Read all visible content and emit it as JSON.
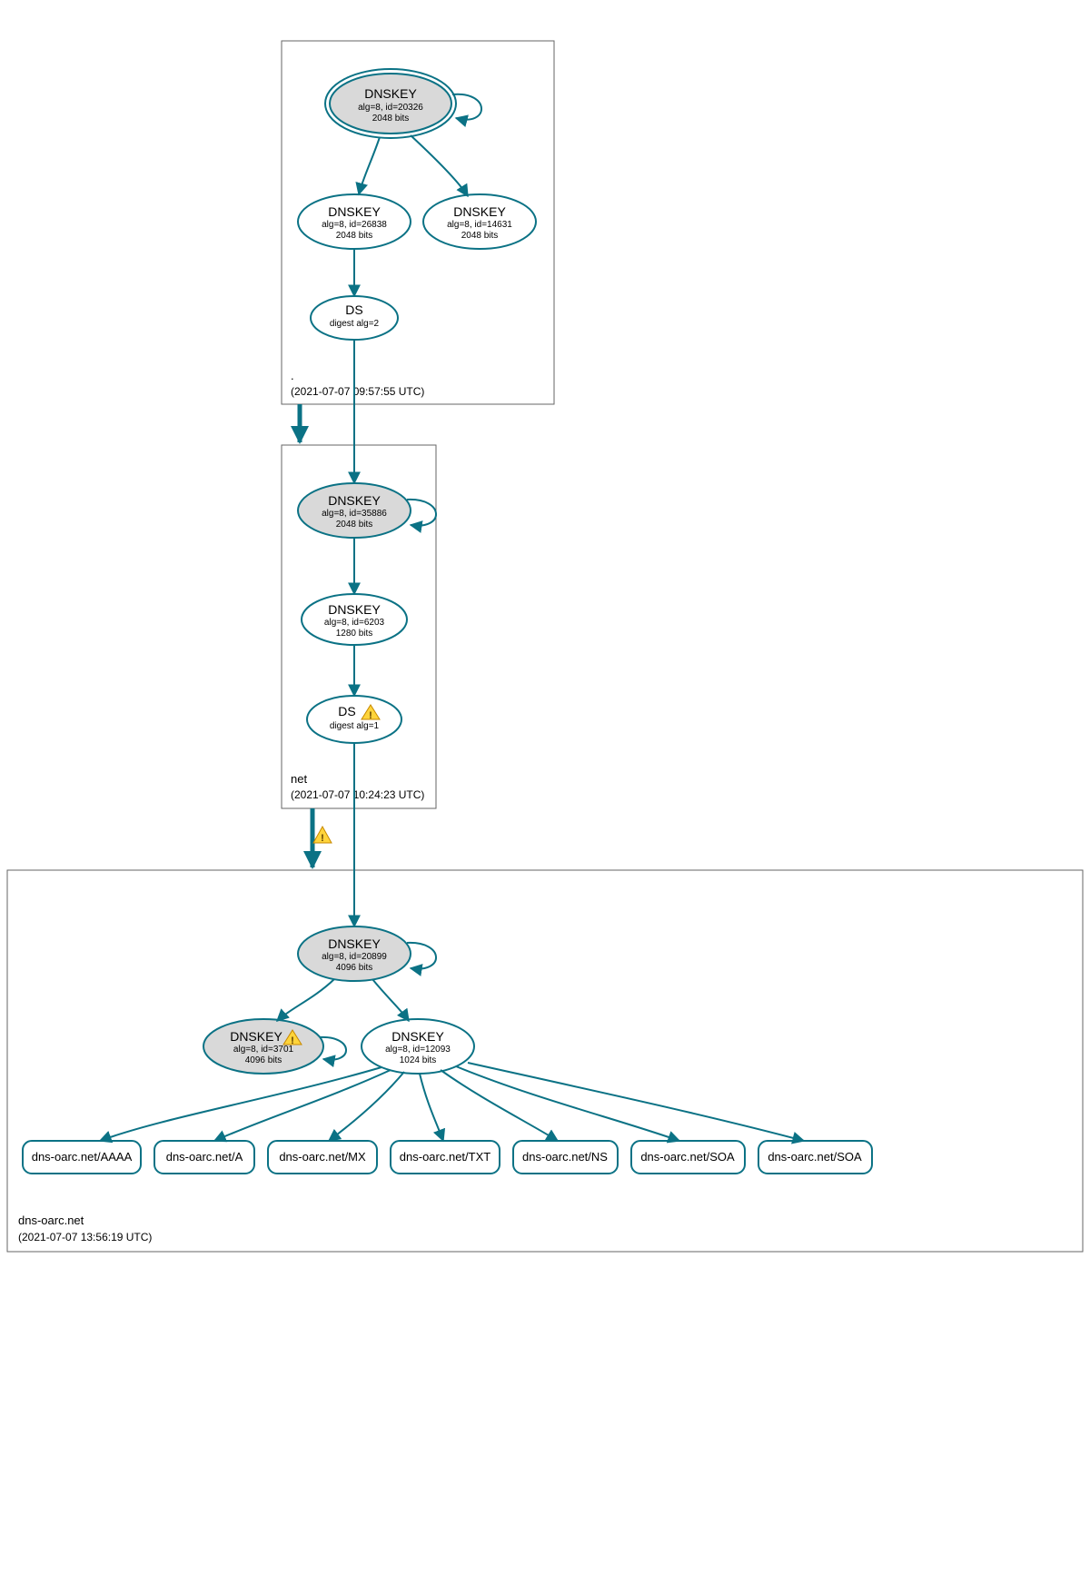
{
  "colors": {
    "edge": "#0b7285",
    "nodeFillGrey": "#d9d9d9",
    "nodeFillWhite": "#ffffff",
    "stroke": "#0b7285"
  },
  "zones": {
    "root": {
      "name": ".",
      "timestamp": "(2021-07-07 09:57:55 UTC)"
    },
    "net": {
      "name": "net",
      "timestamp": "(2021-07-07 10:24:23 UTC)"
    },
    "domain": {
      "name": "dns-oarc.net",
      "timestamp": "(2021-07-07 13:56:19 UTC)"
    }
  },
  "nodes": {
    "root_ksk": {
      "title": "DNSKEY",
      "line1": "alg=8, id=20326",
      "line2": "2048 bits"
    },
    "root_zsk1": {
      "title": "DNSKEY",
      "line1": "alg=8, id=26838",
      "line2": "2048 bits"
    },
    "root_zsk2": {
      "title": "DNSKEY",
      "line1": "alg=8, id=14631",
      "line2": "2048 bits"
    },
    "root_ds": {
      "title": "DS",
      "line1": "digest alg=2"
    },
    "net_ksk": {
      "title": "DNSKEY",
      "line1": "alg=8, id=35886",
      "line2": "2048 bits"
    },
    "net_zsk": {
      "title": "DNSKEY",
      "line1": "alg=8, id=6203",
      "line2": "1280 bits"
    },
    "net_ds": {
      "title": "DS",
      "line1": "digest alg=1"
    },
    "dom_ksk": {
      "title": "DNSKEY",
      "line1": "alg=8, id=20899",
      "line2": "4096 bits"
    },
    "dom_zsk_old": {
      "title": "DNSKEY",
      "line1": "alg=8, id=3701",
      "line2": "4096 bits"
    },
    "dom_zsk": {
      "title": "DNSKEY",
      "line1": "alg=8, id=12093",
      "line2": "1024 bits"
    }
  },
  "records": {
    "aaaa": "dns-oarc.net/AAAA",
    "a": "dns-oarc.net/A",
    "mx": "dns-oarc.net/MX",
    "txt": "dns-oarc.net/TXT",
    "ns": "dns-oarc.net/NS",
    "soa1": "dns-oarc.net/SOA",
    "soa2": "dns-oarc.net/SOA"
  }
}
